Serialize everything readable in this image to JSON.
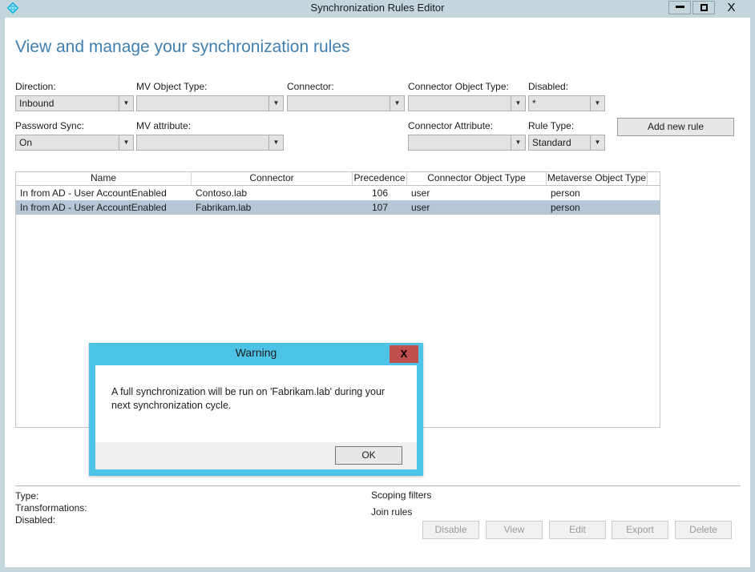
{
  "window": {
    "title": "Synchronization Rules Editor",
    "icon": "azure-ad-connect-diamond-icon",
    "minimize_label": "Minimize",
    "maximize_label": "Maximize",
    "close_label": "X",
    "titlebar_color": "#c5d5dc"
  },
  "page": {
    "heading": "View and manage your synchronization rules",
    "heading_color": "#3f7fb0"
  },
  "filters": {
    "direction": {
      "label": "Direction:",
      "value": "Inbound"
    },
    "mv_object_type": {
      "label": "MV Object Type:",
      "value": ""
    },
    "connector": {
      "label": "Connector:",
      "value": ""
    },
    "connector_object_type": {
      "label": "Connector Object Type:",
      "value": ""
    },
    "disabled": {
      "label": "Disabled:",
      "value": "*"
    },
    "password_sync": {
      "label": "Password Sync:",
      "value": "On"
    },
    "mv_attribute": {
      "label": "MV attribute:",
      "value": ""
    },
    "connector_attribute": {
      "label": "Connector Attribute:",
      "value": ""
    },
    "rule_type": {
      "label": "Rule Type:",
      "value": "Standard"
    }
  },
  "actions": {
    "add_new_rule": "Add new rule"
  },
  "rules_table": {
    "columns": [
      "Name",
      "Connector",
      "Precedence",
      "Connector Object Type",
      "Metaverse Object Type"
    ],
    "rows": [
      {
        "name": "In from AD - User AccountEnabled",
        "connector": "Contoso.lab",
        "precedence": "106",
        "connector_object_type": "user",
        "metaverse_object_type": "person",
        "selected": false
      },
      {
        "name": "In from AD - User AccountEnabled",
        "connector": "Fabrikam.lab",
        "precedence": "107",
        "connector_object_type": "user",
        "metaverse_object_type": "person",
        "selected": true
      }
    ],
    "selected_row_color": "#b6c6d6"
  },
  "details": {
    "left": [
      "Type:",
      "Transformations:",
      "Disabled:"
    ],
    "right": [
      "Scoping filters",
      "Join rules"
    ]
  },
  "bottom_buttons": [
    {
      "label": "Disable",
      "enabled": false
    },
    {
      "label": "View",
      "enabled": false
    },
    {
      "label": "Edit",
      "enabled": false
    },
    {
      "label": "Export",
      "enabled": false
    },
    {
      "label": "Delete",
      "enabled": false
    }
  ],
  "dialog": {
    "title": "Warning",
    "close_label": "X",
    "close_color": "#c0504d",
    "header_color": "#4ec3e8",
    "message": "A full synchronization will be run on 'Fabrikam.lab' during your next synchronization cycle.",
    "ok_label": "OK"
  }
}
